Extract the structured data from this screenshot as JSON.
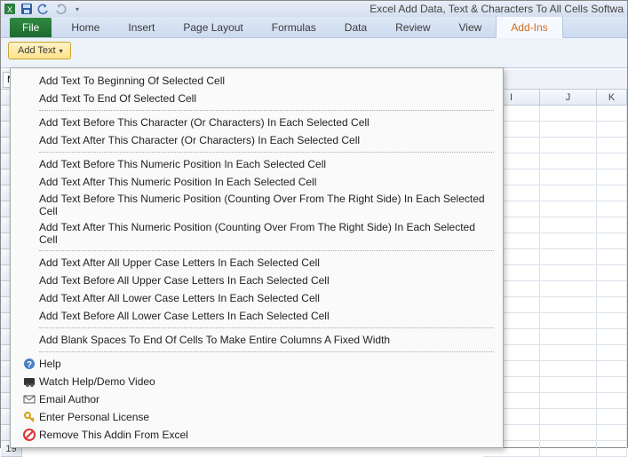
{
  "title": "Excel Add Data, Text & Characters To All Cells Softwa",
  "qat": {
    "save": "save-icon",
    "undo": "undo-icon",
    "redo": "redo-icon"
  },
  "tabs": {
    "file": "File",
    "items": [
      "Home",
      "Insert",
      "Page Layout",
      "Formulas",
      "Data",
      "Review",
      "View",
      "Add-Ins"
    ],
    "active": "Add-Ins"
  },
  "ribbon": {
    "add_text_label": "Add Text"
  },
  "namebox": {
    "value": "N"
  },
  "dropdown": {
    "group1": [
      "Add Text To Beginning Of Selected Cell",
      "Add Text To End Of Selected Cell"
    ],
    "group2": [
      "Add Text Before This Character (Or Characters) In Each Selected Cell",
      "Add Text After This Character (Or Characters) In Each Selected Cell"
    ],
    "group3": [
      "Add Text Before This Numeric Position In Each Selected Cell",
      "Add Text After This Numeric Position In Each Selected Cell",
      "Add Text Before This Numeric Position (Counting Over From The Right Side) In Each Selected Cell",
      "Add Text After This Numeric Position (Counting Over From The Right Side) In Each Selected Cell"
    ],
    "group4": [
      "Add Text After All Upper Case Letters In Each Selected Cell",
      "Add Text Before All Upper Case Letters In Each Selected Cell",
      "Add Text After All Lower Case Letters In Each Selected Cell",
      "Add Text Before All Lower Case Letters In Each Selected Cell"
    ],
    "group5": [
      "Add Blank Spaces To End Of Cells To Make Entire Columns A Fixed Width"
    ],
    "footer": [
      {
        "icon": "help-icon",
        "label": "Help"
      },
      {
        "icon": "video-icon",
        "label": "Watch Help/Demo Video"
      },
      {
        "icon": "email-icon",
        "label": "Email Author"
      },
      {
        "icon": "key-icon",
        "label": "Enter Personal License"
      },
      {
        "icon": "remove-icon",
        "label": "Remove This Addin From Excel"
      }
    ]
  },
  "columns": [
    "I",
    "J",
    "K"
  ],
  "row_last": "19"
}
